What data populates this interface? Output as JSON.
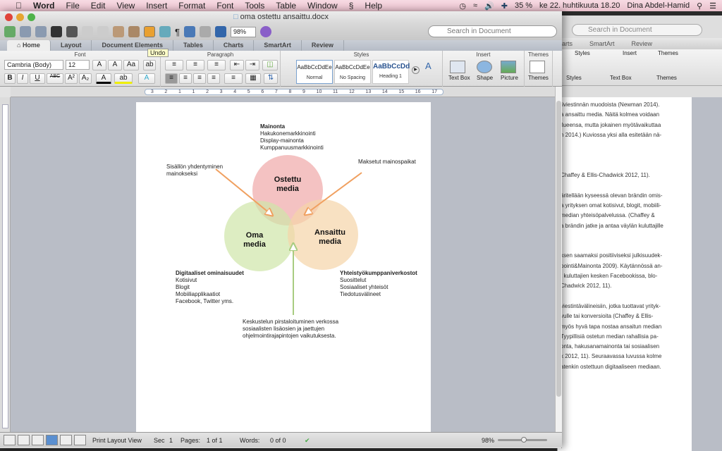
{
  "menubar": {
    "app": "Word",
    "items": [
      "File",
      "Edit",
      "View",
      "Insert",
      "Format",
      "Font",
      "Tools",
      "Table",
      "Window",
      "Help"
    ],
    "battery": "35 %",
    "datetime": "ke 22. huhtikuuta  18.20",
    "user": "Dina Abdel-Hamid"
  },
  "window": {
    "title": "oma ostettu ansaittu.docx",
    "zoom": "98%",
    "search_placeholder": "Search in Document",
    "tooltip": "Undo"
  },
  "tabs": [
    "Home",
    "Layout",
    "Document Elements",
    "Tables",
    "Charts",
    "SmartArt",
    "Review"
  ],
  "ribbon": {
    "font_group": "Font",
    "font_name": "Cambria (Body)",
    "font_size": "12",
    "paragraph_group": "Paragraph",
    "styles_group": "Styles",
    "styles": [
      {
        "sample": "AaBbCcDdEe",
        "name": "Normal"
      },
      {
        "sample": "AaBbCcDdEe",
        "name": "No Spacing"
      },
      {
        "sample": "AaBbCcDd",
        "name": "Heading 1"
      }
    ],
    "insert_group": "Insert",
    "insert_items": [
      "Text Box",
      "Shape",
      "Picture"
    ],
    "themes_group": "Themes",
    "themes_label": "Themes"
  },
  "ruler": {
    "ticks": [
      "3",
      "2",
      "1",
      "1",
      "2",
      "3",
      "4",
      "5",
      "6",
      "7",
      "8",
      "9",
      "10",
      "11",
      "12",
      "13",
      "14",
      "15",
      "16",
      "17"
    ]
  },
  "diagram": {
    "circles": [
      {
        "label1": "Ostettu",
        "label2": "media",
        "color": "#f0a8a8"
      },
      {
        "label1": "Oma",
        "label2": "media",
        "color": "#cfe6a8"
      },
      {
        "label1": "Ansaittu",
        "label2": "media",
        "color": "#f5d4a8"
      }
    ],
    "top_block": {
      "title": "Mainonta",
      "lines": [
        "Hakukonemarkkinointi",
        "Display-mainonta",
        "Kumppanuusmarkkinointi"
      ]
    },
    "left_block": {
      "title": "Digitaaliset ominaisuudet",
      "lines": [
        "Kotisivut",
        "Blogit",
        "Mobiiliapplikaatiot",
        "Facebook, Twitter yms."
      ]
    },
    "right_block": {
      "title": "Yhteistyökumppaniverkostot",
      "lines": [
        "Suosittelut",
        "Sosiaaliset yhteisöt",
        "Tiedotusvälineet"
      ]
    },
    "note_left": [
      "Sisällön yhdentyminen",
      "mainokseksi"
    ],
    "note_right": [
      "Maksetut mainospaikat"
    ],
    "note_bottom": [
      "Keskustelun pirstaloituminen verkossa",
      "sosiaalisten lisäosien ja jaettujen",
      "ohjelmointirajapintojen vaikutuksesta."
    ],
    "arrow_orange": "#f0a060",
    "arrow_green": "#a8cc80"
  },
  "status": {
    "view": "Print Layout View",
    "sec_label": "Sec",
    "sec": "1",
    "pages_label": "Pages:",
    "pages": "1 of 1",
    "words_label": "Words:",
    "words": "0 of 0",
    "zoom": "98%"
  },
  "back_window": {
    "search_placeholder": "Search in Document",
    "tabs": [
      "arts",
      "SmartArt",
      "Review"
    ],
    "groups": [
      "Styles",
      "Insert",
      "Themes"
    ],
    "items": [
      "Styles",
      "Text Box",
      "Themes"
    ],
    "lines": [
      "tiviestinnän muodoista (Newman 2014).",
      "a ansaittu media. Näitä kolmea voidaan",
      "ilueensa, mutta jokainen myötävaikuttaa",
      "n 2014.) Kuviossa yksi alla esitetään nä-",
      "",
      "",
      "",
      "Chaffey & Ellis-Chadwick 2012, 11).",
      "",
      "äritellään kyseessä olevan brändin omis-",
      "a yrityksen omat kotisivut, blogit, mobiili-",
      "  median yhteisöpalvelussa. (Chaffey &",
      "a brändin jatke ja antaa väylän kuluttajille",
      "",
      "",
      "ksen saamaksi positiiviseksi julkisuudek-",
      "pointi&Mainonta 2009). Käytännössä an-",
      "t kuluttajien kesken Facebookissa, blo-",
      "Chadwick 2012, 11).",
      "",
      "viestintävälineisiin, jotka tuottavat yrityk-",
      "vulle tai konversioita (Chaffey & Ellis-",
      "myös hyvä tapa nostaa ansaitun median",
      "Tyypillisiä ostetun median rahallisia pa-",
      "onta, hakusanamainonta tai sosiaalisen",
      "k 2012, 11). Seuraavassa luvussa kolme",
      "atenkin ostettuun digitaaliseen mediaan."
    ]
  }
}
